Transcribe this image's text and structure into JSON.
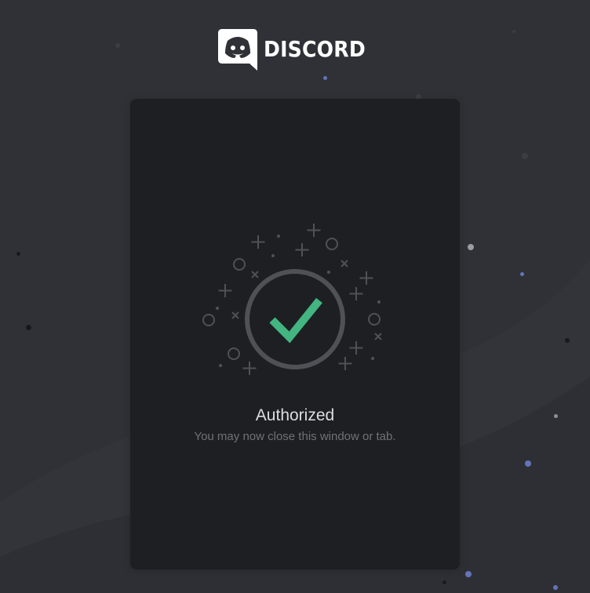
{
  "brand": {
    "logo_text": "DISCORD",
    "logo_icon": "discord-logo-icon"
  },
  "status": {
    "title": "Authorized",
    "subtitle": "You may now close this window or tab.",
    "icon": "check-circle-icon"
  },
  "colors": {
    "background": "#303137",
    "card": "#1e1f23",
    "success": "#43b581",
    "ring": "#4f5156",
    "sparkles": "#4f5156",
    "muted_text": "#6f7278",
    "title_text": "#dcddde"
  }
}
